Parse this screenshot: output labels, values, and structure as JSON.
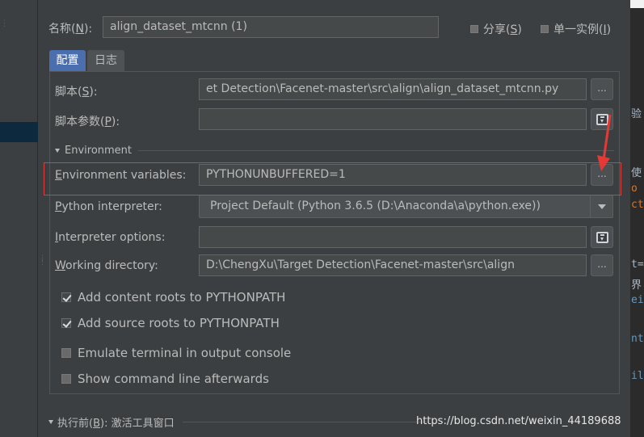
{
  "header": {
    "name_label": "名称(",
    "name_mnemonic": "N",
    "name_label_end": "):",
    "name_value": "align_dataset_mtcnn (1)",
    "share_label": "分享(",
    "share_mnemonic": "S",
    "share_end": ")",
    "single_label": "单一实例(",
    "single_mnemonic": "I",
    "single_end": ")"
  },
  "tabs": {
    "config": "配置",
    "log": "日志"
  },
  "form": {
    "script_label": "脚本(",
    "script_mnemonic": "S",
    "script_label_end": "):",
    "script_value": "et Detection\\Facenet-master\\src\\align\\align_dataset_mtcnn.py",
    "params_label": "脚本参数(",
    "params_mnemonic": "P",
    "params_label_end": "):",
    "params_value": "",
    "environment_section": "Environment",
    "env_vars_mnemonic": "E",
    "env_vars_label_rest": "nvironment variables:",
    "env_vars_value": "PYTHONUNBUFFERED=1",
    "interpreter_mnemonic": "P",
    "interpreter_label_rest": "ython interpreter:",
    "interpreter_value": "Project Default (Python 3.6.5 (D:\\Anaconda\\a\\python.exe))",
    "interp_options_mnemonic": "I",
    "interp_options_label_rest": "nterpreter options:",
    "interp_options_value": "",
    "workdir_mnemonic": "W",
    "workdir_label_rest": "orking directory:",
    "workdir_value": "D:\\ChengXu\\Target Detection\\Facenet-master\\src\\align",
    "browse_label": "..."
  },
  "options": [
    {
      "label": "Add content roots to PYTHONPATH",
      "checked": true
    },
    {
      "label": "Add source roots to PYTHONPATH",
      "checked": true
    },
    {
      "label": "Emulate terminal in output console",
      "checked": false
    },
    {
      "label": "Show command line afterwards",
      "checked": false
    }
  ],
  "before_launch": {
    "label_start": "执行前(",
    "mnemonic": "B",
    "label_end": "): 激活工具窗口"
  },
  "background_editor": {
    "snippets": [
      "验",
      "使",
      "o",
      "ct",
      "t=",
      "界",
      "ei",
      "nt",
      "il"
    ]
  },
  "watermark": "https://blog.csdn.net/weixin_44189688",
  "colors": {
    "annotation": "#e53935",
    "tab_active": "#4b6eaf"
  }
}
